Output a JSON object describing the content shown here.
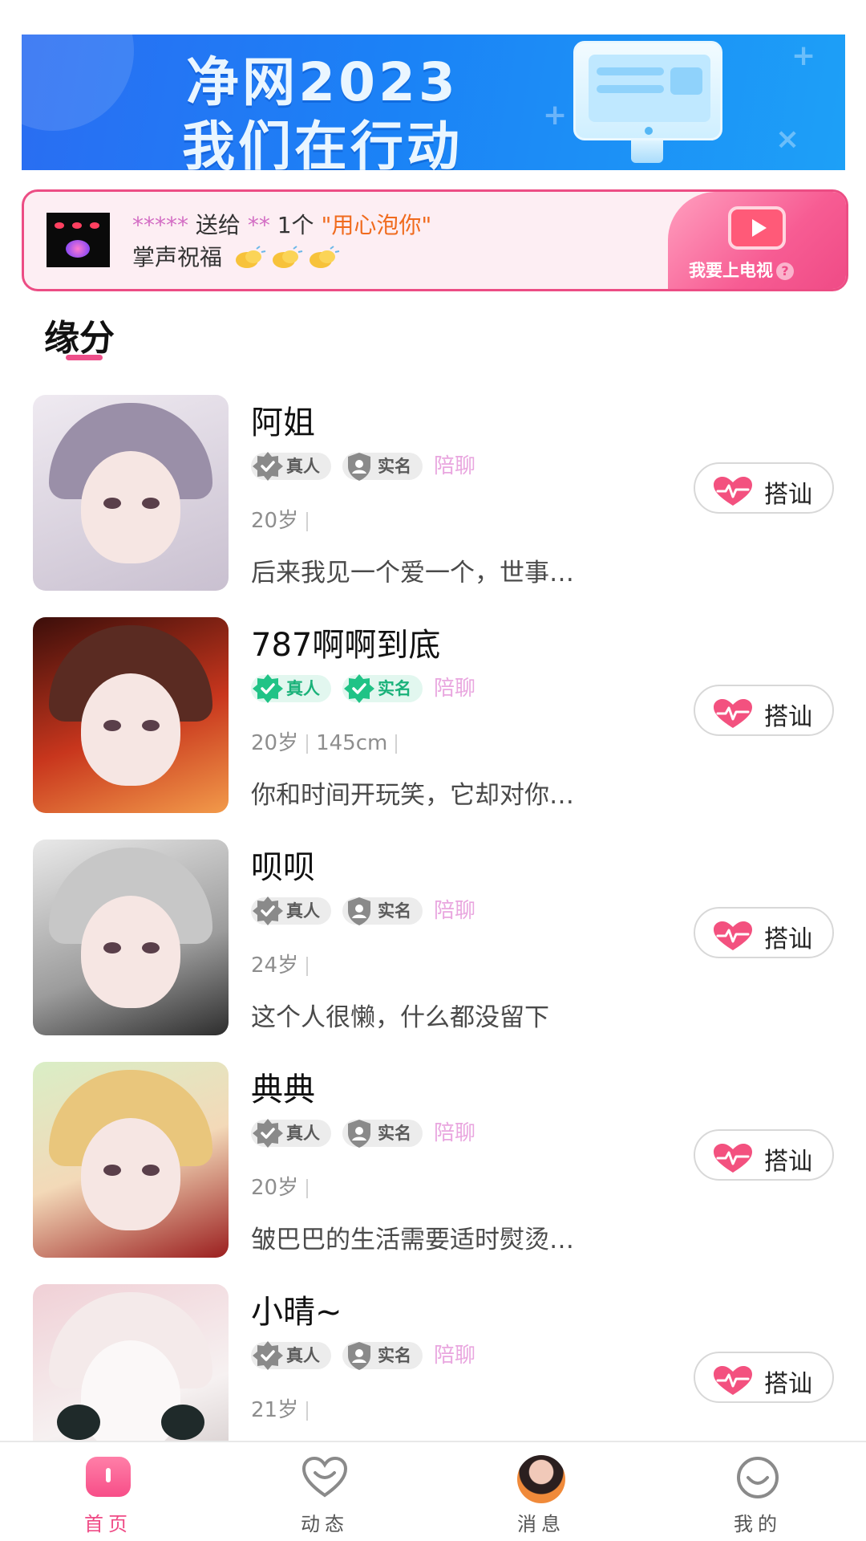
{
  "banner": {
    "line1": "净网2023",
    "line2": "我们在行动"
  },
  "gift_bar": {
    "sender_mask": "*****",
    "sends_text": " 送给 ",
    "receiver_mask": "**",
    "count_text": " 1个 ",
    "gift_name": "\"用心泡你\"",
    "line2": "掌声祝福",
    "tv_label": "我要上电视",
    "help_glyph": "?"
  },
  "section": {
    "title": "缘分"
  },
  "profiles": [
    {
      "name": "阿姐",
      "tag_real": "真人",
      "tag_verified": "实名",
      "verified_style": "gray",
      "service": "陪聊",
      "age": "20岁",
      "height": "",
      "bio": "后来我见一个爱一个，世事…",
      "action": "搭讪"
    },
    {
      "name": "787啊啊到底",
      "tag_real": "真人",
      "tag_verified": "实名",
      "verified_style": "green",
      "service": "陪聊",
      "age": "20岁",
      "height": "145cm",
      "bio": "你和时间开玩笑，它却对你…",
      "action": "搭讪"
    },
    {
      "name": "呗呗",
      "tag_real": "真人",
      "tag_verified": "实名",
      "verified_style": "gray",
      "service": "陪聊",
      "age": "24岁",
      "height": "",
      "bio": "这个人很懒，什么都没留下",
      "action": "搭讪"
    },
    {
      "name": "典典",
      "tag_real": "真人",
      "tag_verified": "实名",
      "verified_style": "gray",
      "service": "陪聊",
      "age": "20岁",
      "height": "",
      "bio": "皱巴巴的生活需要适时熨烫…",
      "action": "搭讪"
    },
    {
      "name": "小晴~",
      "tag_real": "真人",
      "tag_verified": "实名",
      "verified_style": "gray",
      "service": "陪聊",
      "age": "21岁",
      "height": "",
      "bio": "",
      "action": "搭讪"
    }
  ],
  "nav": {
    "active": "home",
    "home": "首页",
    "moments": "动态",
    "messages": "消息",
    "mine": "我的"
  },
  "colors": {
    "accent": "#ef4b86",
    "verified_green": "#20c386",
    "service_text": "#e9a6df",
    "gift_name": "#f06b1e"
  },
  "icons": {
    "tag_real": "star-badge-icon",
    "tag_verified": "shield-user-icon",
    "chat": "heartbeat-icon",
    "nav_home": "home-icon",
    "nav_moments": "heart-outline-icon",
    "nav_messages": "avatar-icon",
    "nav_mine": "smile-icon"
  }
}
